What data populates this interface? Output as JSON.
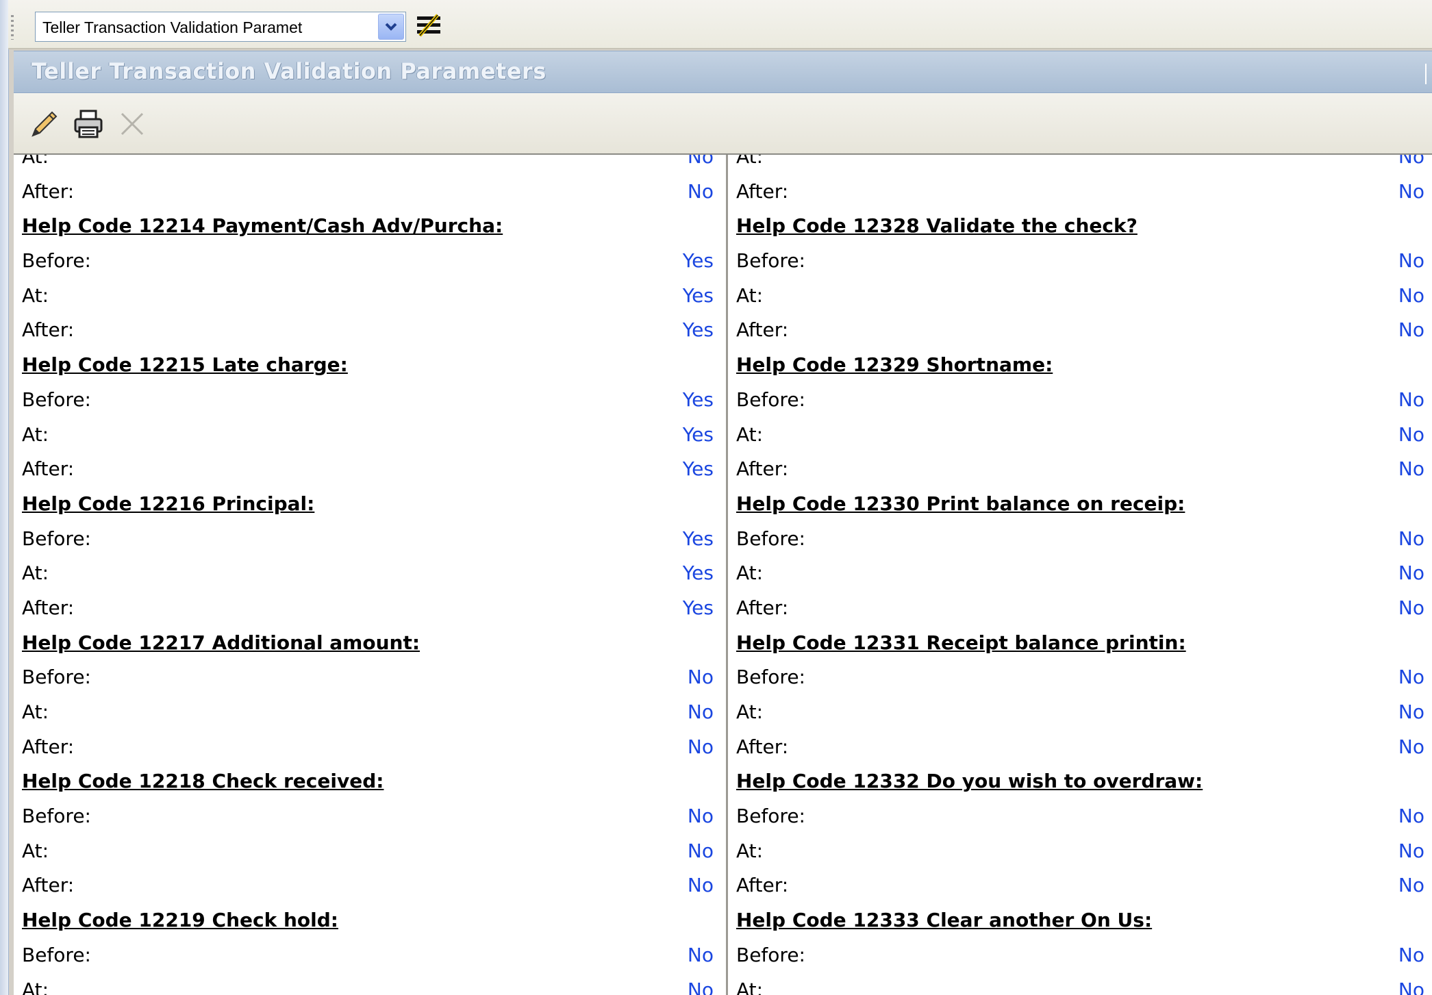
{
  "toolbar": {
    "selector_value": "Teller Transaction Validation Paramet",
    "layout_icon": "layout-list-icon"
  },
  "window": {
    "title": "Teller Transaction Validation Parameters"
  },
  "actions": {
    "icons": [
      "pencil-edit-icon",
      "printer-icon",
      "close-x-icon"
    ]
  },
  "left_rows": [
    {
      "type": "item",
      "label": "At:",
      "value": "No"
    },
    {
      "type": "item",
      "label": "After:",
      "value": "No"
    },
    {
      "type": "header",
      "label": "Help Code 12214  Payment/Cash Adv/Purcha:"
    },
    {
      "type": "item",
      "label": "Before:",
      "value": "Yes"
    },
    {
      "type": "item",
      "label": "At:",
      "value": "Yes"
    },
    {
      "type": "item",
      "label": "After:",
      "value": "Yes"
    },
    {
      "type": "header",
      "label": "Help Code 12215  Late charge:"
    },
    {
      "type": "item",
      "label": "Before:",
      "value": "Yes"
    },
    {
      "type": "item",
      "label": "At:",
      "value": "Yes"
    },
    {
      "type": "item",
      "label": "After:",
      "value": "Yes"
    },
    {
      "type": "header",
      "label": "Help Code 12216  Principal:"
    },
    {
      "type": "item",
      "label": "Before:",
      "value": "Yes"
    },
    {
      "type": "item",
      "label": "At:",
      "value": "Yes"
    },
    {
      "type": "item",
      "label": "After:",
      "value": "Yes"
    },
    {
      "type": "header",
      "label": "Help Code 12217  Additional amount:"
    },
    {
      "type": "item",
      "label": "Before:",
      "value": "No"
    },
    {
      "type": "item",
      "label": "At:",
      "value": "No"
    },
    {
      "type": "item",
      "label": "After:",
      "value": "No"
    },
    {
      "type": "header",
      "label": "Help Code 12218  Check received:"
    },
    {
      "type": "item",
      "label": "Before:",
      "value": "No"
    },
    {
      "type": "item",
      "label": "At:",
      "value": "No"
    },
    {
      "type": "item",
      "label": "After:",
      "value": "No"
    },
    {
      "type": "header",
      "label": "Help Code 12219  Check hold:"
    },
    {
      "type": "item",
      "label": "Before:",
      "value": "No"
    },
    {
      "type": "item",
      "label": "At:",
      "value": "No"
    }
  ],
  "right_rows": [
    {
      "type": "item",
      "label": "At:",
      "value": "No"
    },
    {
      "type": "item",
      "label": "After:",
      "value": "No"
    },
    {
      "type": "header",
      "label": "Help Code 12328  Validate the check?"
    },
    {
      "type": "item",
      "label": "Before:",
      "value": "No"
    },
    {
      "type": "item",
      "label": "At:",
      "value": "No"
    },
    {
      "type": "item",
      "label": "After:",
      "value": "No"
    },
    {
      "type": "header",
      "label": "Help Code 12329  Shortname:"
    },
    {
      "type": "item",
      "label": "Before:",
      "value": "No"
    },
    {
      "type": "item",
      "label": "At:",
      "value": "No"
    },
    {
      "type": "item",
      "label": "After:",
      "value": "No"
    },
    {
      "type": "header",
      "label": "Help Code 12330  Print balance on receip:"
    },
    {
      "type": "item",
      "label": "Before:",
      "value": "No"
    },
    {
      "type": "item",
      "label": "At:",
      "value": "No"
    },
    {
      "type": "item",
      "label": "After:",
      "value": "No"
    },
    {
      "type": "header",
      "label": "Help Code 12331  Receipt balance printin:"
    },
    {
      "type": "item",
      "label": "Before:",
      "value": "No"
    },
    {
      "type": "item",
      "label": "At:",
      "value": "No"
    },
    {
      "type": "item",
      "label": "After:",
      "value": "No"
    },
    {
      "type": "header",
      "label": "Help Code 12332  Do you wish to overdraw:"
    },
    {
      "type": "item",
      "label": "Before:",
      "value": "No"
    },
    {
      "type": "item",
      "label": "At:",
      "value": "No"
    },
    {
      "type": "item",
      "label": "After:",
      "value": "No"
    },
    {
      "type": "header",
      "label": "Help Code 12333  Clear another On Us:"
    },
    {
      "type": "item",
      "label": "Before:",
      "value": "No"
    },
    {
      "type": "item",
      "label": "At:",
      "value": "No"
    }
  ]
}
